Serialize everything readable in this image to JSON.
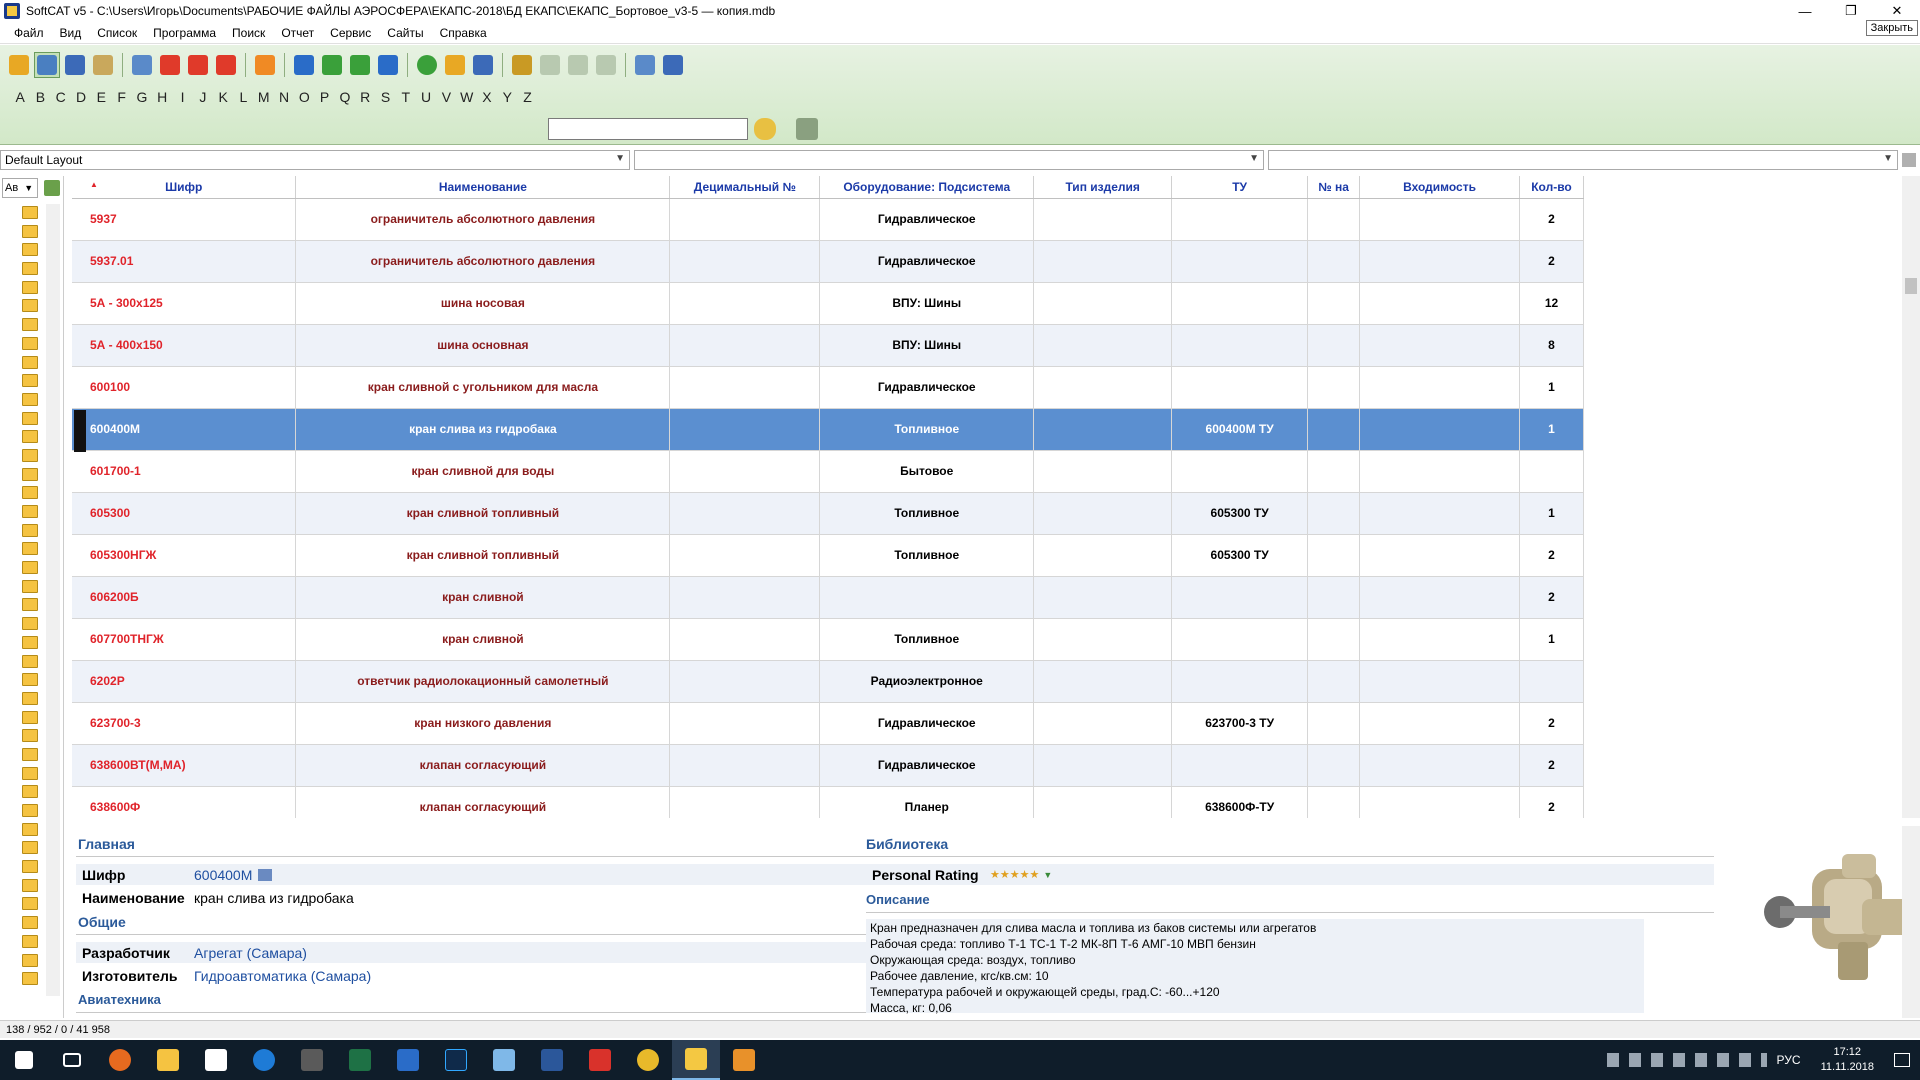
{
  "window": {
    "title": "SoftCAT v5 - C:\\Users\\Игорь\\Documents\\РАБОЧИЕ ФАЙЛЫ АЭРОСФЕРА\\ЕКАПС-2018\\БД ЕКАПС\\ЕКАПС_Бортовое_v3-5 — копия.mdb",
    "minimize": "—",
    "maximize": "❐",
    "close": "✕",
    "close_tooltip": "Закрыть"
  },
  "menu": [
    "Файл",
    "Вид",
    "Список",
    "Программа",
    "Поиск",
    "Отчет",
    "Сервис",
    "Сайты",
    "Справка"
  ],
  "alphabet": [
    "A",
    "B",
    "C",
    "D",
    "E",
    "F",
    "G",
    "H",
    "I",
    "J",
    "K",
    "L",
    "M",
    "N",
    "O",
    "P",
    "Q",
    "R",
    "S",
    "T",
    "U",
    "V",
    "W",
    "X",
    "Y",
    "Z"
  ],
  "search": {
    "value": ""
  },
  "layout": {
    "selected": "Default Layout",
    "filter2": "",
    "filter3": ""
  },
  "left_panel": {
    "sort_combo": "Ав"
  },
  "grid": {
    "sort_marker": "▲",
    "columns": [
      "Шифр",
      "Наименование",
      "Децимальный №",
      "Оборудование: Подсистема",
      "Тип изделия",
      "ТУ",
      "№ на",
      "Входимость",
      "Кол-во"
    ],
    "rows": [
      {
        "code": "5937",
        "name": "ограничитель абсолютного давления",
        "dec": "",
        "equip": "Гидравлическое",
        "type": "",
        "tu": "",
        "num": "",
        "inc": "",
        "qty": "2"
      },
      {
        "code": "5937.01",
        "name": "ограничитель абсолютного давления",
        "dec": "",
        "equip": "Гидравлическое",
        "type": "",
        "tu": "",
        "num": "",
        "inc": "",
        "qty": "2"
      },
      {
        "code": "5А - 300х125",
        "name": "шина носовая",
        "dec": "",
        "equip": "ВПУ: Шины",
        "type": "",
        "tu": "",
        "num": "",
        "inc": "",
        "qty": "12"
      },
      {
        "code": "5А - 400х150",
        "name": "шина основная",
        "dec": "",
        "equip": "ВПУ: Шины",
        "type": "",
        "tu": "",
        "num": "",
        "inc": "",
        "qty": "8"
      },
      {
        "code": "600100",
        "name": "кран сливной с угольником для масла",
        "dec": "",
        "equip": "Гидравлическое",
        "type": "",
        "tu": "",
        "num": "",
        "inc": "",
        "qty": "1"
      },
      {
        "code": "600400М",
        "name": "кран слива из гидробака",
        "dec": "",
        "equip": "Топливное",
        "type": "",
        "tu": "600400М ТУ",
        "num": "",
        "inc": "",
        "qty": "1",
        "selected": true
      },
      {
        "code": "601700-1",
        "name": "кран сливной для воды",
        "dec": "",
        "equip": "Бытовое",
        "type": "",
        "tu": "",
        "num": "",
        "inc": "",
        "qty": ""
      },
      {
        "code": "605300",
        "name": "кран сливной топливный",
        "dec": "",
        "equip": "Топливное",
        "type": "",
        "tu": "605300 ТУ",
        "num": "",
        "inc": "",
        "qty": "1"
      },
      {
        "code": "605300НГЖ",
        "name": "кран сливной топливный",
        "dec": "",
        "equip": "Топливное",
        "type": "",
        "tu": "605300 ТУ",
        "num": "",
        "inc": "",
        "qty": "2"
      },
      {
        "code": "606200Б",
        "name": "кран сливной",
        "dec": "",
        "equip": "",
        "type": "",
        "tu": "",
        "num": "",
        "inc": "",
        "qty": "2"
      },
      {
        "code": "607700ТНГЖ",
        "name": "кран сливной",
        "dec": "",
        "equip": "Топливное",
        "type": "",
        "tu": "",
        "num": "",
        "inc": "",
        "qty": "1"
      },
      {
        "code": "6202Р",
        "name": "ответчик радиолокационный самолетный",
        "dec": "",
        "equip": "Радиоэлектронное",
        "type": "",
        "tu": "",
        "num": "",
        "inc": "",
        "qty": ""
      },
      {
        "code": "623700-3",
        "name": "кран низкого давления",
        "dec": "",
        "equip": "Гидравлическое",
        "type": "",
        "tu": "623700-3 ТУ",
        "num": "",
        "inc": "",
        "qty": "2"
      },
      {
        "code": "638600ВТ(М,МА)",
        "name": "клапан согласующий",
        "dec": "",
        "equip": "Гидравлическое",
        "type": "",
        "tu": "",
        "num": "",
        "inc": "",
        "qty": "2"
      },
      {
        "code": "638600Ф",
        "name": "клапан согласующий",
        "dec": "",
        "equip": "Планер",
        "type": "",
        "tu": "638600Ф-ТУ",
        "num": "",
        "inc": "",
        "qty": "2"
      }
    ]
  },
  "detail": {
    "main_header": "Главная",
    "code_label": "Шифр",
    "code_value": "600400М",
    "name_label": "Наименование",
    "name_value": "кран слива из гидробака",
    "general_header": "Общие",
    "dev_label": "Разработчик",
    "dev_value": "Агрегат (Самара)",
    "mfr_label": "Изготовитель",
    "mfr_value": "Гидроавтоматика (Самара)",
    "avia_header": "Авиатехника",
    "library_header": "Библиотека",
    "rating_label": "Personal Rating",
    "rating_stars": "★★★★★",
    "desc_header": "Описание",
    "desc_lines": [
      "Кран предназначен для слива масла и топлива из баков системы или агрегатов",
      "Рабочая среда: топливо Т-1 ТС-1 Т-2 МК-8П Т-6 АМГ-10 МВП бензин",
      "Окружающая среда: воздух, топливо",
      "Рабочее давление, кгс/кв.см: 10",
      "Температура рабочей и окружающей среды, град.С: -60...+120",
      "Масса, кг: 0,06"
    ]
  },
  "status": {
    "text": "138 / 952 / 0 / 41 958"
  },
  "taskbar": {
    "lang": "РУС",
    "time": "17:12",
    "date": "11.11.2018"
  },
  "colors": {
    "toolbar_bg": "#d9ecd0",
    "selected_row": "#5b8fd0",
    "code_red": "#e0232a",
    "header_blue": "#1b3aa8"
  }
}
